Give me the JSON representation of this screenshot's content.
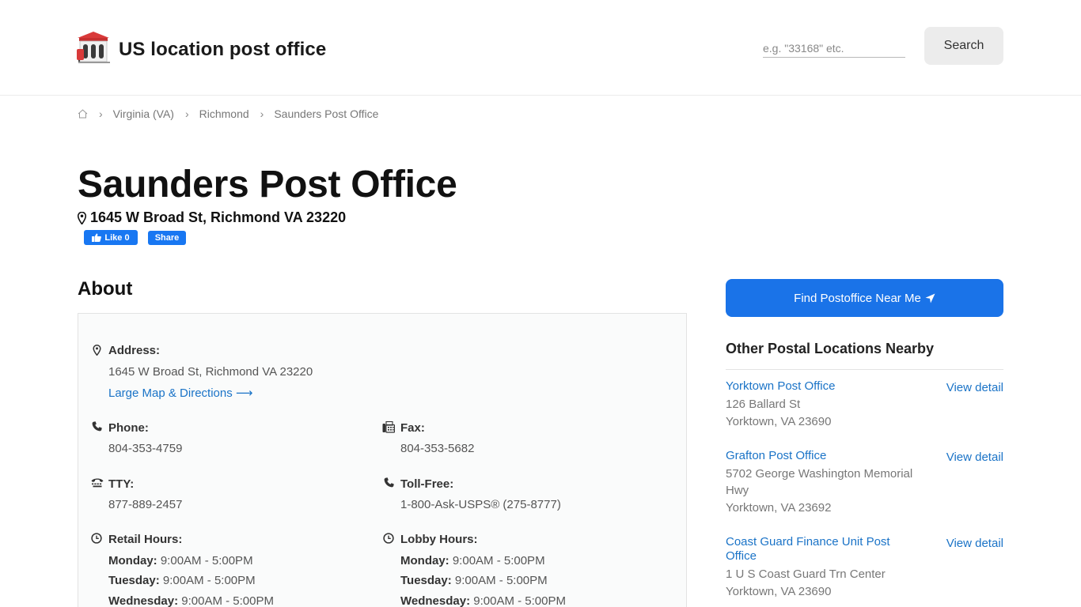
{
  "header": {
    "site_title": "US location post office",
    "search_placeholder": "e.g. \"33168\" etc.",
    "search_button": "Search"
  },
  "breadcrumb": {
    "items": [
      "Virginia (VA)",
      "Richmond",
      "Saunders Post Office"
    ]
  },
  "office": {
    "title": "Saunders Post Office",
    "address_line": "1645 W Broad St, Richmond VA 23220"
  },
  "social": {
    "like_label": "Like 0",
    "share_label": "Share"
  },
  "about": {
    "heading": "About",
    "address_label": "Address:",
    "address_value": "1645 W Broad St, Richmond VA 23220",
    "map_link": "Large Map & Directions ⟶",
    "phone_label": "Phone:",
    "phone_value": "804-353-4759",
    "fax_label": "Fax:",
    "fax_value": "804-353-5682",
    "tty_label": "TTY:",
    "tty_value": "877-889-2457",
    "tollfree_label": "Toll-Free:",
    "tollfree_value": "1-800-Ask-USPS® (275-8777)",
    "retail_label": "Retail Hours:",
    "lobby_label": "Lobby Hours:",
    "retail_hours": [
      {
        "day": "Monday:",
        "hours": " 9:00AM - 5:00PM"
      },
      {
        "day": "Tuesday:",
        "hours": " 9:00AM - 5:00PM"
      },
      {
        "day": "Wednesday:",
        "hours": " 9:00AM - 5:00PM"
      }
    ],
    "lobby_hours": [
      {
        "day": "Monday:",
        "hours": " 9:00AM - 5:00PM"
      },
      {
        "day": "Tuesday:",
        "hours": " 9:00AM - 5:00PM"
      },
      {
        "day": "Wednesday:",
        "hours": " 9:00AM - 5:00PM"
      }
    ]
  },
  "sidebar": {
    "find_button": "Find Postoffice Near Me",
    "heading": "Other Postal Locations Nearby",
    "view_detail_label": "View detail",
    "items": [
      {
        "name": "Yorktown Post Office",
        "street": "126 Ballard St",
        "city": "Yorktown, VA 23690"
      },
      {
        "name": "Grafton Post Office",
        "street": "5702 George Washington Memorial Hwy",
        "city": "Yorktown, VA 23692"
      },
      {
        "name": "Coast Guard Finance Unit Post Office",
        "street": "1 U S Coast Guard Trn Center",
        "city": "Yorktown, VA 23690"
      }
    ]
  },
  "colors": {
    "link": "#1a73c7",
    "primary_button": "#1a73e8",
    "facebook": "#1877f2",
    "card_bg": "#fafbfb"
  },
  "icons": {
    "logo": "post-office-building-icon",
    "home": "home-icon",
    "pin": "map-pin-icon",
    "phone": "phone-icon",
    "fax": "fax-icon",
    "tty": "tty-icon",
    "clock": "clock-icon",
    "location_arrow": "location-arrow-icon",
    "thumb": "thumbs-up-icon"
  }
}
